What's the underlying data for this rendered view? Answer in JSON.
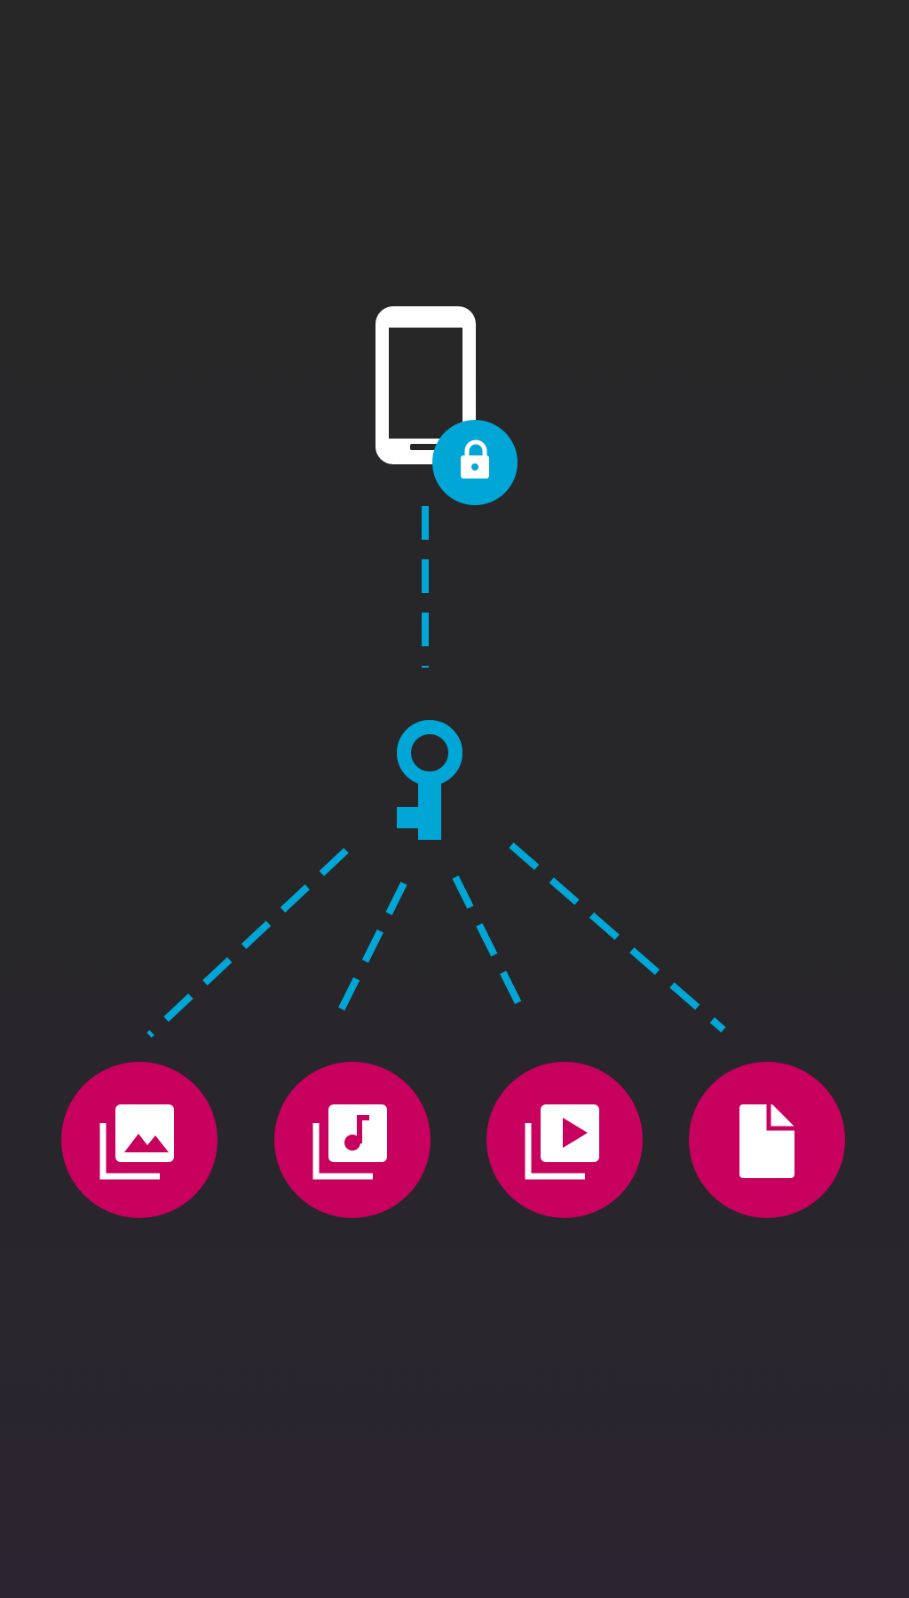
{
  "diagram": {
    "nodes": [
      {
        "id": "device",
        "icon": "smartphone-icon",
        "badge_icon": "lock-icon"
      },
      {
        "id": "key",
        "icon": "key-icon"
      },
      {
        "id": "photos",
        "icon": "photo-library-icon"
      },
      {
        "id": "music",
        "icon": "music-library-icon"
      },
      {
        "id": "videos",
        "icon": "video-library-icon"
      },
      {
        "id": "files",
        "icon": "file-icon"
      }
    ],
    "edges": [
      {
        "from": "device",
        "to": "key",
        "style": "dashed"
      },
      {
        "from": "key",
        "to": "photos",
        "style": "dashed"
      },
      {
        "from": "key",
        "to": "music",
        "style": "dashed"
      },
      {
        "from": "key",
        "to": "videos",
        "style": "dashed"
      },
      {
        "from": "key",
        "to": "files",
        "style": "dashed"
      }
    ]
  },
  "colors": {
    "background": "#272727",
    "accent_blue": "#00a6d6",
    "accent_magenta": "#c8005e",
    "icon_white": "#ffffff"
  }
}
